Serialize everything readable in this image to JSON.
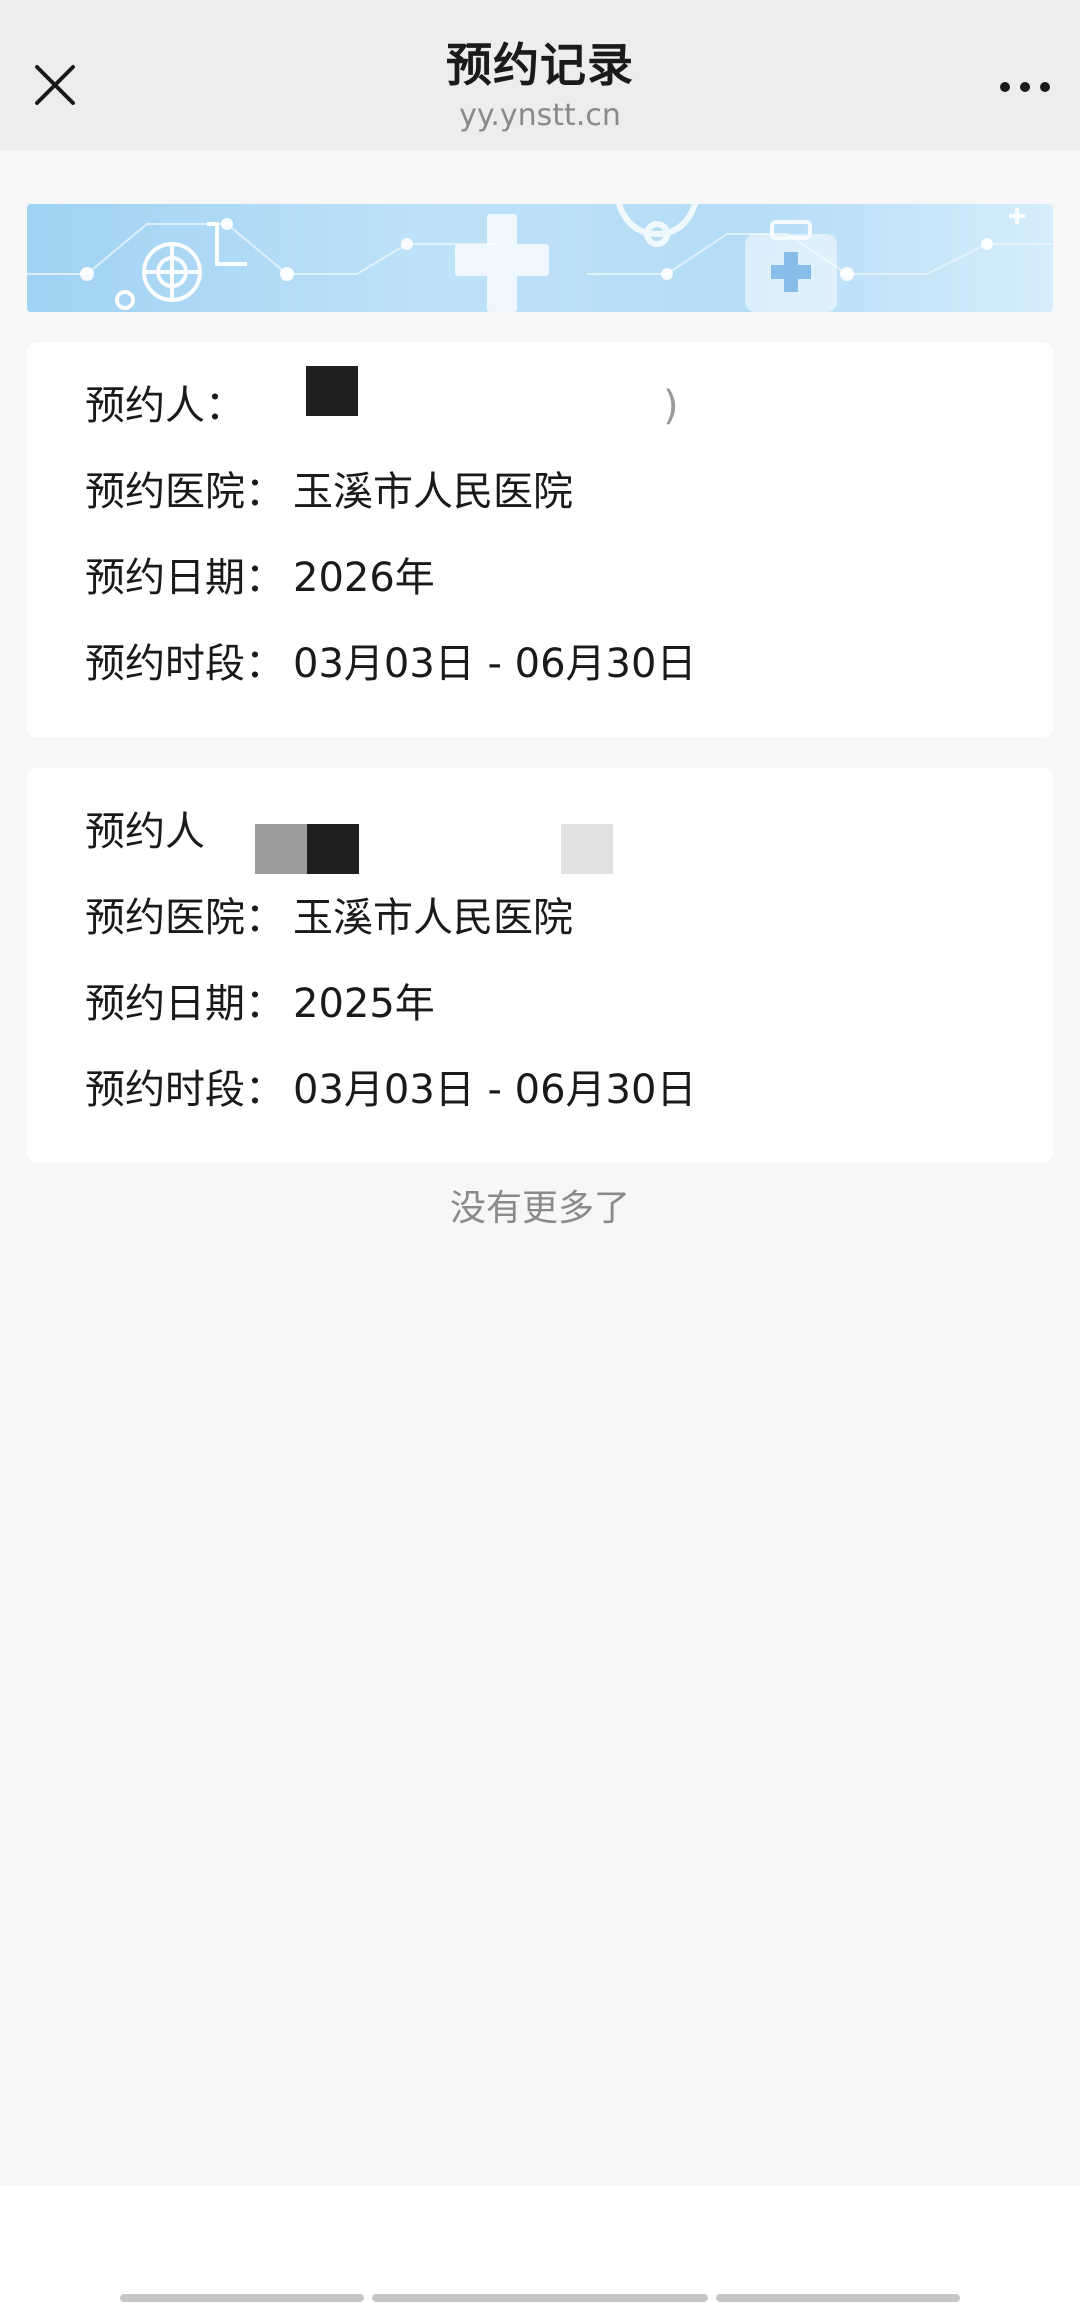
{
  "header": {
    "title": "预约记录",
    "subtitle": "yy.ynstt.cn",
    "close_icon": "close-icon",
    "more_icon": "more-dots-icon"
  },
  "banner": {
    "icon": "medical-banner-image"
  },
  "records": [
    {
      "person_label": "预约人：",
      "person_value_suffix": ")",
      "hospital_label": "预约医院：",
      "hospital_value": "玉溪市人民医院",
      "date_label": "预约日期：",
      "date_value": "2026年",
      "period_label": "预约时段：",
      "period_value": "03月03日 - 06月30日"
    },
    {
      "person_label": "预约人",
      "hospital_label": "预约医院：",
      "hospital_value": "玉溪市人民医院",
      "date_label": "预约日期：",
      "date_value": "2025年",
      "period_label": "预约时段：",
      "period_value": "03月03日 - 06月30日"
    }
  ],
  "footer": {
    "no_more_text": "没有更多了"
  },
  "colors": {
    "header_bg": "#ededed",
    "page_bg": "#f7f7f8",
    "card_bg": "#ffffff",
    "muted_text": "#8a8a8a",
    "banner_blue": "#9fd2f3"
  }
}
